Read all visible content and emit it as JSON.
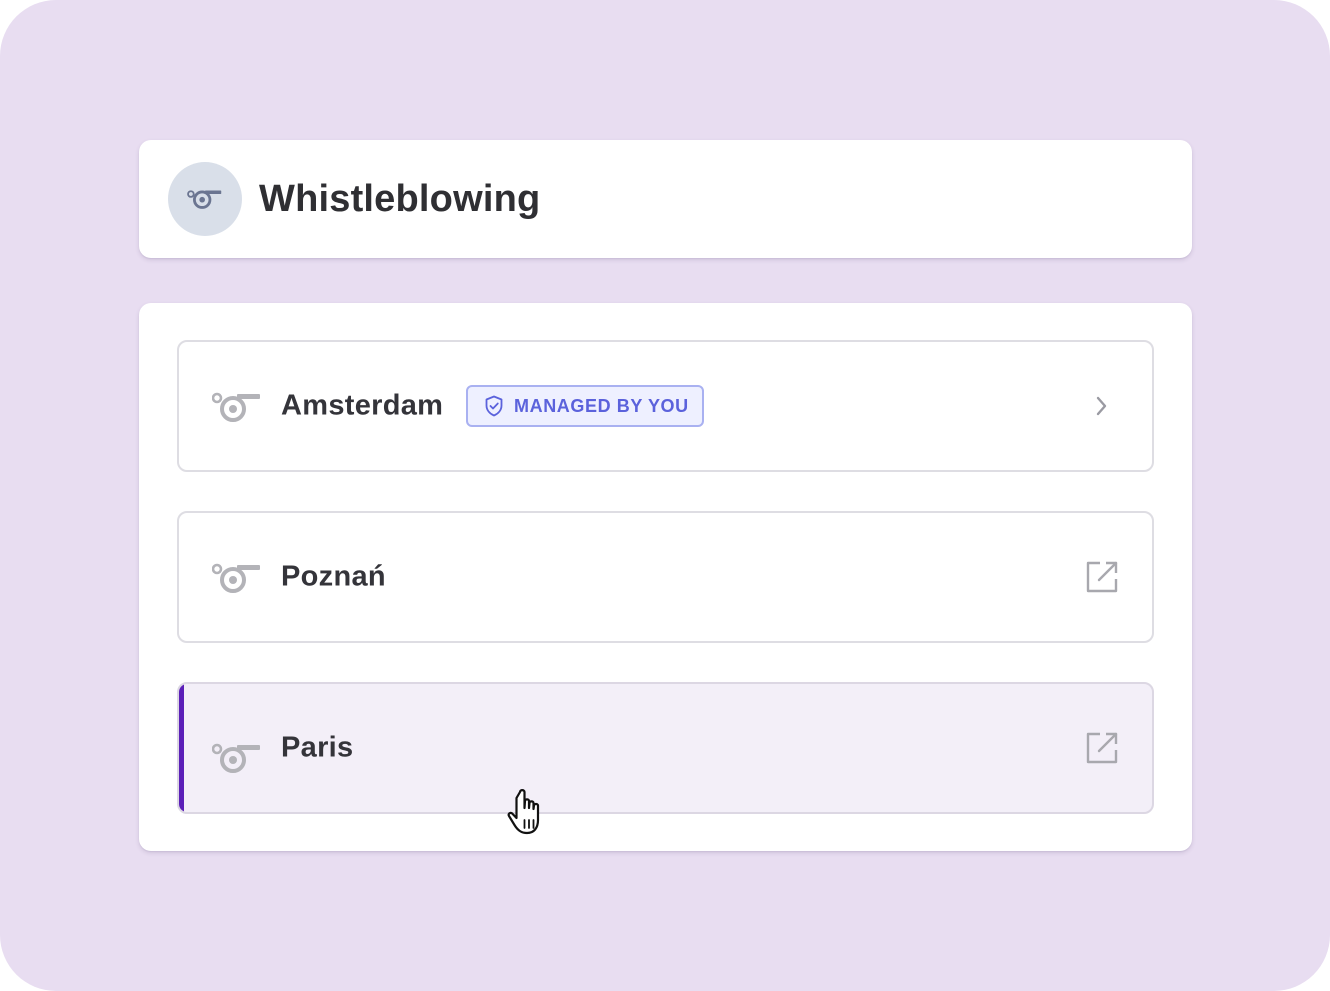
{
  "header": {
    "title": "Whistleblowing",
    "icon": "whistle-icon"
  },
  "channels": [
    {
      "label": "Amsterdam",
      "icon": "whistle-icon",
      "badge": "MANAGED BY YOU",
      "badge_icon": "shield-check-icon",
      "trailing_icon": "chevron-right-icon"
    },
    {
      "label": "Poznań",
      "icon": "whistle-icon",
      "trailing_icon": "external-link-icon"
    },
    {
      "label": "Paris",
      "icon": "whistle-icon",
      "trailing_icon": "external-link-icon",
      "state": "hovered"
    }
  ],
  "colors": {
    "background": "#e8ddf1",
    "accent": "#5b1fb8",
    "badge_text": "#5b62dc",
    "badge_border": "#a9b1f1",
    "hover_row": "#f3eff8"
  }
}
